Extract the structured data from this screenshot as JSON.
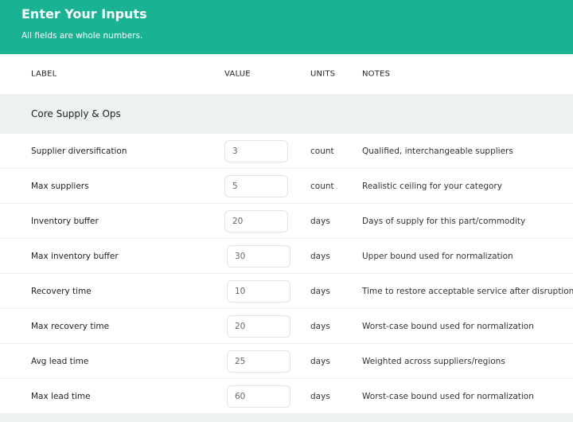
{
  "header": {
    "title": "Enter Your Inputs",
    "subtitle": "All fields are whole numbers."
  },
  "columns": {
    "label": "LABEL",
    "value": "VALUE",
    "units": "UNITS",
    "notes": "NOTES"
  },
  "section": {
    "title": "Core Supply & Ops"
  },
  "rows": [
    {
      "label": "Supplier diversification",
      "value": "3",
      "units": "count",
      "notes": "Qualified, interchangeable suppliers"
    },
    {
      "label": "Max suppliers",
      "value": "5",
      "units": "count",
      "notes": "Realistic ceiling for your category"
    },
    {
      "label": "Inventory buffer",
      "value": "20",
      "units": "days",
      "notes": "Days of supply for this part/commodity"
    },
    {
      "label": "Max inventory buffer",
      "value": "30",
      "units": "days",
      "notes": "Upper bound used for normalization"
    },
    {
      "label": "Recovery time",
      "value": "10",
      "units": "days",
      "notes": "Time to restore acceptable service after disruption"
    },
    {
      "label": "Max recovery time",
      "value": "20",
      "units": "days",
      "notes": "Worst-case bound used for normalization"
    },
    {
      "label": "Avg lead time",
      "value": "25",
      "units": "days",
      "notes": "Weighted across suppliers/regions"
    },
    {
      "label": "Max lead time",
      "value": "60",
      "units": "days",
      "notes": "Worst-case bound used for normalization"
    }
  ]
}
